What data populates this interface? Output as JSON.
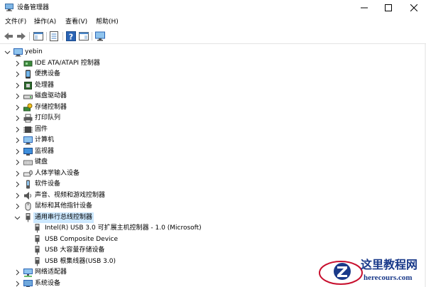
{
  "window": {
    "title": "设备管理器",
    "controls": {
      "minimize": "minimize",
      "maximize": "maximize",
      "close": "close"
    }
  },
  "menu": [
    "文件(F)",
    "操作(A)",
    "查看(V)",
    "帮助(H)"
  ],
  "toolbar": {
    "buttons": [
      "back-icon",
      "forward-icon",
      "show-hide-console-tree-icon",
      "properties-icon",
      "help-icon",
      "update-driver-icon",
      "monitor-scan-icon"
    ]
  },
  "tree": {
    "root": "yebin",
    "categories": [
      "IDE ATA/ATAPI 控制器",
      "便携设备",
      "处理器",
      "磁盘驱动器",
      "存储控制器",
      "打印队列",
      "固件",
      "计算机",
      "监视器",
      "键盘",
      "人体学输入设备",
      "软件设备",
      "声音、视频和游戏控制器",
      "鼠标和其他指针设备",
      "通用串行总线控制器"
    ],
    "usb_children": [
      "Intel(R) USB 3.0 可扩展主机控制器 - 1.0 (Microsoft)",
      "USB Composite Device",
      "USB 大容量存储设备",
      "USB 根集线器(USB 3.0)"
    ],
    "after": [
      "网络适配器",
      "系统设备"
    ],
    "expanded": "通用串行总线控制器",
    "selected": "通用串行总线控制器"
  },
  "watermark": {
    "main": "这里教程网",
    "url": "herecours.com"
  },
  "colors": {
    "selection": "#cce8ff",
    "watermark": "#1a3a8a",
    "watermark_red": "#c8102e"
  }
}
